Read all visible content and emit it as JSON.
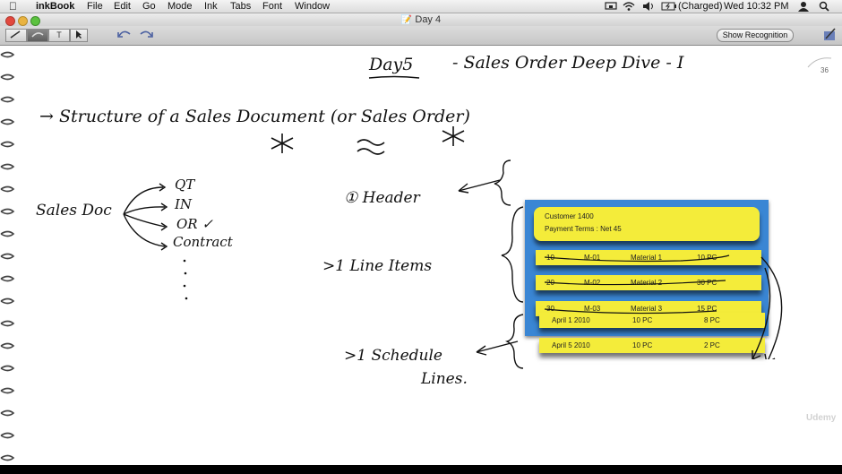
{
  "menubar": {
    "app_name": "inkBook",
    "items": [
      "File",
      "Edit",
      "Go",
      "Mode",
      "Ink",
      "Tabs",
      "Font",
      "Window"
    ],
    "battery": "(Charged)",
    "clock": "Wed 10:32 PM"
  },
  "window": {
    "title": "Day 4"
  },
  "toolbar": {
    "show_recognition_label": "Show Recognition",
    "text_tool_label": "T"
  },
  "page": {
    "number": "36"
  },
  "handwriting": {
    "title_day": "Day5",
    "title_rest": "- Sales Order Deep Dive - I",
    "structure": "→ Structure of a Sales Document (or Sales Order)",
    "sales_doc": "Sales Doc",
    "branches": [
      "QT",
      "IN",
      "OR ✓",
      "Contract"
    ],
    "header": "① Header",
    "line_items": ">1 Line Items",
    "schedule_1": ">1 Schedule",
    "schedule_2": "Lines."
  },
  "slide": {
    "header_lines": [
      "Customer 1400",
      "Payment Terms : Net 45"
    ],
    "line_items": [
      {
        "item": "10",
        "code": "M-01",
        "material": "Material 1",
        "qty": "10 PC"
      },
      {
        "item": "20",
        "code": "M-02",
        "material": "Material 2",
        "qty": "30 PC"
      },
      {
        "item": "30",
        "code": "M-03",
        "material": "Material 3",
        "qty": "15 PC"
      }
    ],
    "schedule_lines": [
      {
        "date": "April 1 2010",
        "ordered": "10 PC",
        "confirmed": "8 PC"
      },
      {
        "date": "April 5 2010",
        "ordered": "10 PC",
        "confirmed": "2 PC"
      }
    ]
  },
  "watermark": "Udemy",
  "colors": {
    "slide_blue": "#3a86d4",
    "bar_yellow": "#f4ec3a"
  }
}
